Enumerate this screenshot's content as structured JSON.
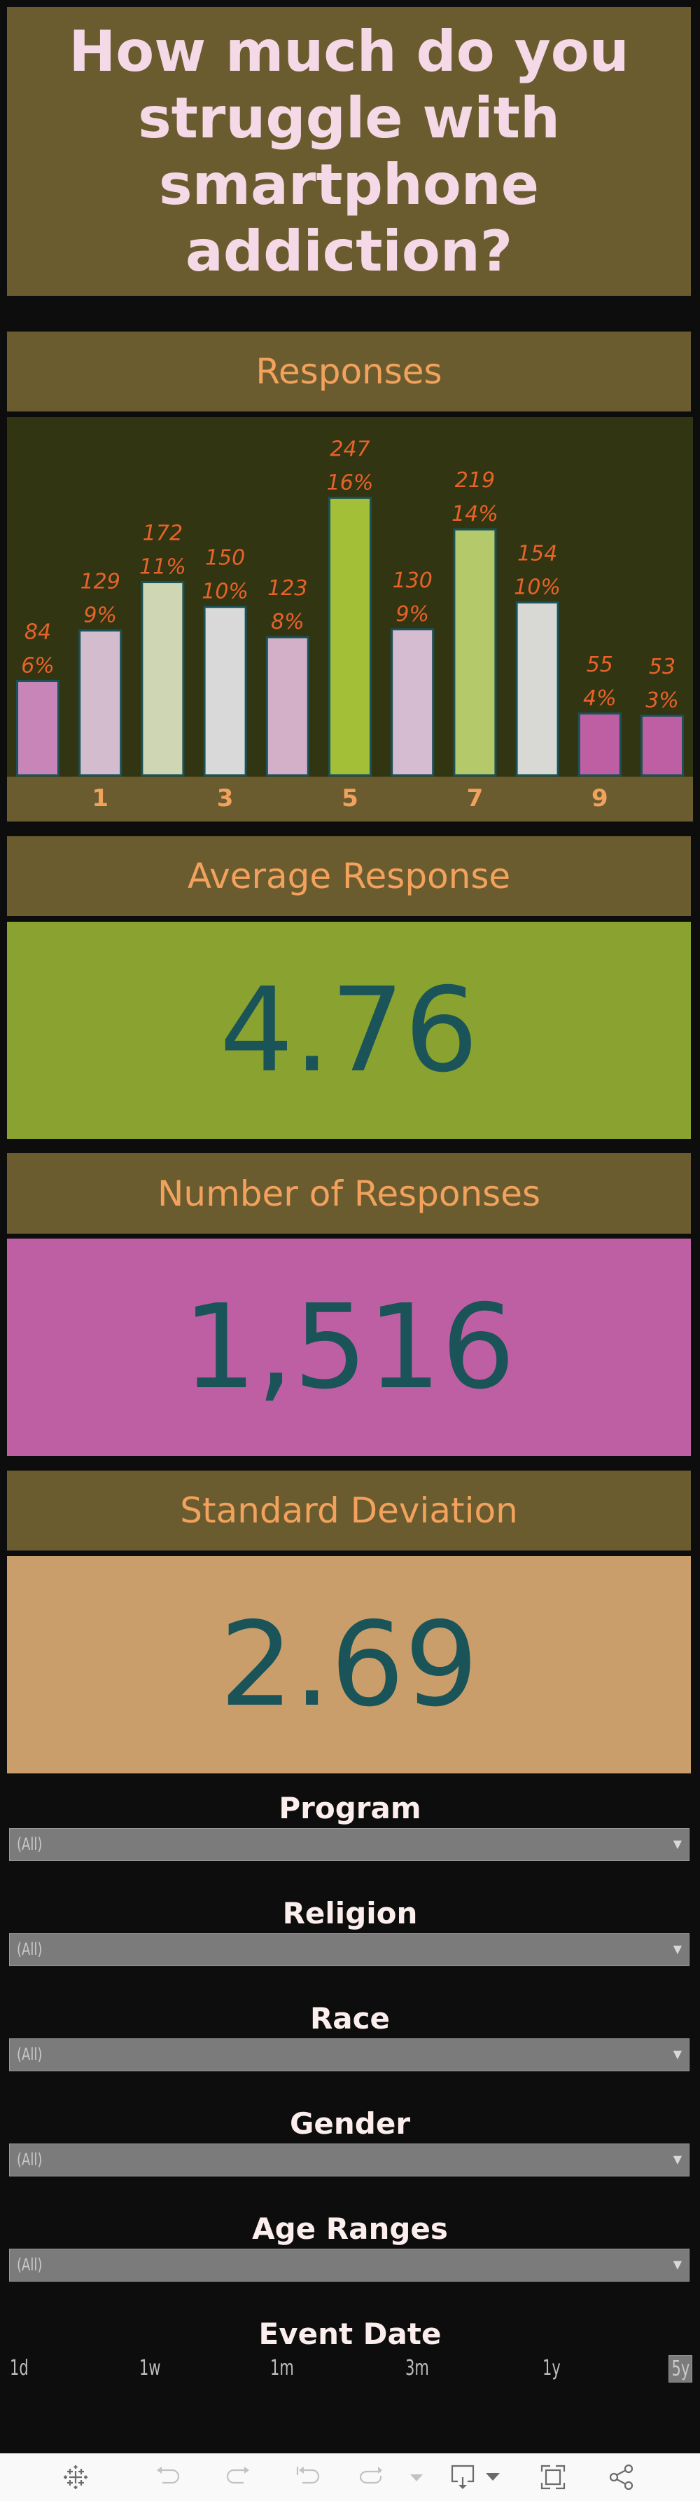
{
  "title": {
    "lines": [
      "How much do you",
      "struggle with",
      "smartphone",
      "addiction?"
    ]
  },
  "responses_section": {
    "header": "Responses"
  },
  "chart_data": {
    "type": "bar",
    "title": "Responses",
    "xlabel": "",
    "ylabel": "",
    "categories": [
      "0",
      "1",
      "2",
      "3",
      "4",
      "5",
      "6",
      "7",
      "8",
      "9",
      "10"
    ],
    "values": [
      84,
      129,
      172,
      150,
      123,
      247,
      130,
      219,
      154,
      55,
      53
    ],
    "percent_labels": [
      "6%",
      "9%",
      "11%",
      "10%",
      "8%",
      "16%",
      "9%",
      "14%",
      "10%",
      "4%",
      "3%"
    ],
    "x_tick_labels": [
      "1",
      "3",
      "5",
      "7",
      "9"
    ],
    "x_tick_categories": [
      "1",
      "3",
      "5",
      "7",
      "9"
    ],
    "ylim": [
      0,
      319
    ],
    "grid": false,
    "bar_colors": [
      "#c785b8",
      "#d4bccf",
      "#cfd6b3",
      "#d9d9d9",
      "#d4b0c8",
      "#a3bf37",
      "#d5bcd0",
      "#b4c96a",
      "#d8d9d4",
      "#bf5fa3",
      "#bf5fa3"
    ],
    "bar_outline_color": "#1a5258",
    "label_color": "#e8622a"
  },
  "kpis": {
    "average": {
      "header": "Average Response",
      "value": "4.76",
      "color": "#8aa22f"
    },
    "count": {
      "header": "Number of Responses",
      "value": "1,516",
      "color": "#bf5fa3"
    },
    "std_dev": {
      "header": "Standard Deviation",
      "value": "2.69",
      "color": "#ca9e6b"
    }
  },
  "filters": [
    {
      "label": "Program",
      "value": "(All)"
    },
    {
      "label": "Religion",
      "value": "(All)"
    },
    {
      "label": "Race",
      "value": "(All)"
    },
    {
      "label": "Gender",
      "value": "(All)"
    },
    {
      "label": "Age Ranges",
      "value": "(All)"
    }
  ],
  "event_date": {
    "label": "Event Date",
    "options": [
      "1d",
      "1w",
      "1m",
      "3m",
      "1y",
      "5y"
    ],
    "selected": "5y"
  },
  "toolbar": {
    "icons": [
      "tableau-logo-icon",
      "undo-icon",
      "redo-icon",
      "revert-icon",
      "refresh-icon",
      "refresh-dropdown-icon",
      "download-icon",
      "download-dropdown-icon",
      "fullscreen-icon",
      "share-icon"
    ],
    "dropdown_arrow": "▼"
  },
  "colors": {
    "background": "#0d0d0d",
    "header_bg": "#6b5c2f",
    "header_text": "#f2a25c",
    "title_text": "#f5d9e6",
    "chart_bg": "#313512",
    "kpi_text": "#1a5459"
  }
}
